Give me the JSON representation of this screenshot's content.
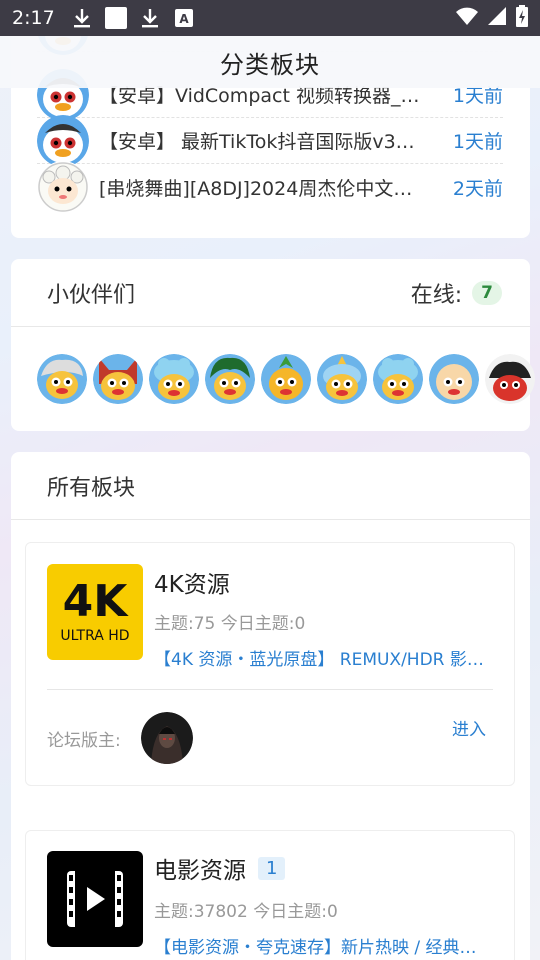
{
  "status": {
    "time": "2:17",
    "icons": [
      "download-icon",
      "square-icon",
      "download-icon",
      "font-icon"
    ],
    "right_icons": [
      "wifi-icon",
      "signal-icon",
      "battery-charging-icon"
    ]
  },
  "page_title": "分类板块",
  "recent_posts": [
    {
      "title": "【安卓】VidCompact 视频转换器_…",
      "time": "1天前",
      "avatar": "duck-avatar"
    },
    {
      "title": "【安卓】 最新TikTok抖音国际版v3…",
      "time": "1天前",
      "avatar": "duck-avatar"
    },
    {
      "title": "[串烧舞曲][A8DJ]2024周杰伦中文…",
      "time": "2天前",
      "avatar": "sheep-avatar"
    }
  ],
  "online": {
    "label": "小伙伴们",
    "count_label": "在线:",
    "count": "7",
    "avatars": [
      "white-hair-duck",
      "cat-duck",
      "frog-duck",
      "green-hair-duck",
      "pineapple-duck",
      "shark-duck",
      "frog-duck",
      "bald-duck",
      "dark-duck"
    ]
  },
  "boards": {
    "label": "所有板块",
    "items": [
      {
        "name": "4K资源",
        "badge": "",
        "stats": "主题:75   今日主题:0",
        "desc": "【4K 资源・蓝光原盘】 REMUX/HDR 影…",
        "logo_text_main": "4K",
        "logo_text_sub": "ULTRA HD",
        "moderator_label": "论坛版主:",
        "enter": "进入"
      },
      {
        "name": "电影资源",
        "badge": "1",
        "stats": "主题:37802   今日主题:0",
        "desc": "【电影资源・夸克速存】新片热映 / 经典…"
      }
    ]
  },
  "colors": {
    "accent": "#2a7fd0",
    "status_bar": "#3d3b45",
    "online_badge": "#2d8a3e",
    "logo_4k": "#f8cc00"
  }
}
